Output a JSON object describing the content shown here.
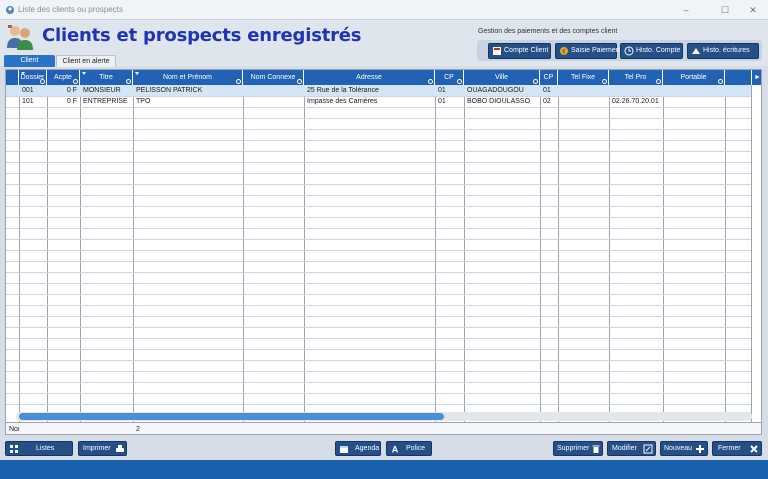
{
  "window": {
    "title": "Liste des clients ou prospects",
    "minimize": "–",
    "maximize": "☐",
    "close": "✕"
  },
  "header": {
    "title": "Clients et prospects enregistrés",
    "payments_label": "Gestion des paiements et des comptes client",
    "buttons": [
      "Compte Client",
      "Saisie Paiement",
      "Histo. Compte",
      "Histo. écritures"
    ]
  },
  "tabs": [
    "Client",
    "Client en alerte"
  ],
  "table": {
    "columns": [
      "Dossier",
      "Acpte",
      "Titre",
      "Nom et Prénom",
      "Nom Connexe",
      "Adresse",
      "CP",
      "Ville",
      "CP",
      "Tel Fixe",
      "Tel Pro",
      "Portable"
    ],
    "rows": [
      [
        "001",
        "0 F",
        "MONSIEUR",
        "PELISSON PATRICK",
        "",
        "25 Rue de la Tolérance",
        "01",
        "OUAGADOUGOU",
        "01",
        "",
        "",
        ""
      ],
      [
        "101",
        "0 F",
        "ENTREPRISE",
        "TPO",
        "",
        "Impasse des Carrières",
        "01",
        "BOBO DIOULASSO",
        "02",
        "",
        "02.26.70.20.01",
        ""
      ]
    ],
    "footer": {
      "label": "Nor",
      "count": "2"
    },
    "scroll_right": "►"
  },
  "bottom_buttons": {
    "listes": "Listes",
    "imprimer": "Imprimer",
    "agenda": "Agenda",
    "police": "Police",
    "supprimer": "Supprimer",
    "modifier": "Modifier",
    "nouveau": "Nouveau",
    "fermer": "Fermer"
  },
  "colors": {
    "accent": "#2262b4",
    "title": "#1f33b8",
    "button": "#244f87",
    "selected_row": "#d3e6f8"
  }
}
